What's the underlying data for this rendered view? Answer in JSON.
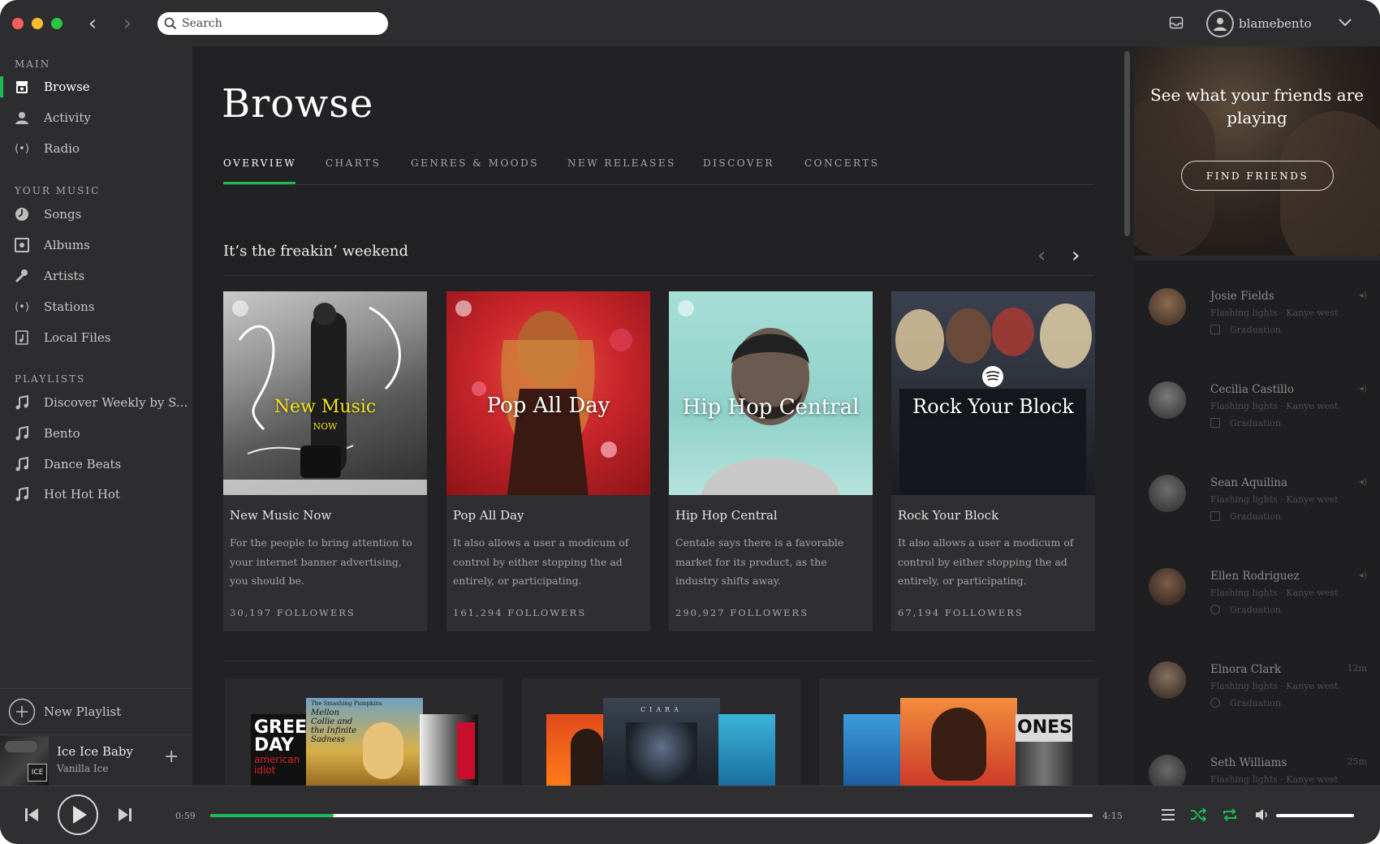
{
  "search": {
    "placeholder": "Search"
  },
  "user": {
    "name": "blamebento"
  },
  "sidebar": {
    "main_header": "MAIN",
    "main_items": [
      {
        "label": "Browse",
        "icon": "browse-icon",
        "active": true
      },
      {
        "label": "Activity",
        "icon": "activity-icon"
      },
      {
        "label": "Radio",
        "icon": "radio-icon"
      }
    ],
    "your_music_header": "YOUR MUSIC",
    "your_music_items": [
      {
        "label": "Songs",
        "icon": "songs-icon"
      },
      {
        "label": "Albums",
        "icon": "albums-icon"
      },
      {
        "label": "Artists",
        "icon": "artists-icon"
      },
      {
        "label": "Stations",
        "icon": "stations-icon"
      },
      {
        "label": "Local Files",
        "icon": "local-files-icon"
      }
    ],
    "playlists_header": "PLAYLISTS",
    "playlists": [
      {
        "label": "Discover Weekly by S..."
      },
      {
        "label": "Bento"
      },
      {
        "label": "Dance Beats"
      },
      {
        "label": "Hot Hot Hot"
      }
    ],
    "new_playlist": "New Playlist",
    "now_playing": {
      "title": "Ice Ice Baby",
      "artist": "Vanilla Ice",
      "cover_text": "ICE"
    }
  },
  "main": {
    "title": "Browse",
    "tabs": [
      "OVERVIEW",
      "CHARTS",
      "GENRES & MOODS",
      "NEW RELEASES",
      "DISCOVER",
      "CONCERTS"
    ],
    "active_tab": "OVERVIEW",
    "shelf_title": "It’s the freakin’ weekend",
    "cards": [
      {
        "art_title": "New Music",
        "art_sub": "NOW",
        "title": "New Music Now",
        "desc": "For the people to bring attention to your internet banner advertising, you should be.",
        "followers": "30,197 FOLLOWERS"
      },
      {
        "art_title": "Pop All Day",
        "title": "Pop All Day",
        "desc": "It also allows a user a modicum of control by either stopping the ad entirely, or participating.",
        "followers": "161,294 FOLLOWERS"
      },
      {
        "art_title": "Hip Hop Central",
        "title": "Hip Hop Central",
        "desc": "Centale says there is a favorable market for its product, as the industry shifts away.",
        "followers": "290,927 FOLLOWERS"
      },
      {
        "art_title": "Rock Your Block",
        "title": "Rock Your Block",
        "desc": "It also allows a user a modicum of control by either stopping the ad entirely, or participating.",
        "followers": "67,194 FOLLOWERS"
      }
    ],
    "album_covers": {
      "a1": [
        "GREEN DAY",
        "american idiot",
        "Mellon Collie and the Infinite Sadness",
        "The Smashing Pumpkins"
      ],
      "a2": [
        "CIARA"
      ],
      "a3": [
        "ONES"
      ]
    }
  },
  "friends": {
    "hero_text": "See what your friends are playing",
    "find_button": "FIND FRIENDS",
    "list": [
      {
        "name": "Josie Fields",
        "track": "Flashing lights · Kanye west",
        "source": "Graduation",
        "status": "◂)"
      },
      {
        "name": "Cecilia Castillo",
        "track": "Flashing lights · Kanye west",
        "source": "Graduation",
        "status": "◂)"
      },
      {
        "name": "Sean Aquilina",
        "track": "Flashing lights · Kanye west",
        "source": "Graduation",
        "status": "◂)"
      },
      {
        "name": "Ellen Rodriguez",
        "track": "Flashing lights · Kanye west",
        "source": "Graduation",
        "status": "◂)"
      },
      {
        "name": "Elnora Clark",
        "track": "Flashing lights · Kanye west",
        "source": "Graduation",
        "status": "12m"
      },
      {
        "name": "Seth Williams",
        "track": "Flashing lights · Kanye west",
        "source": "",
        "status": "25m"
      }
    ]
  },
  "player": {
    "elapsed": "0:59",
    "total": "4:15",
    "progress_percent": 14,
    "volume_percent": 100
  },
  "colors": {
    "accent": "#1db954",
    "sidebar": "#2d2d2f",
    "main": "#222224",
    "friends": "#1f1f21"
  }
}
